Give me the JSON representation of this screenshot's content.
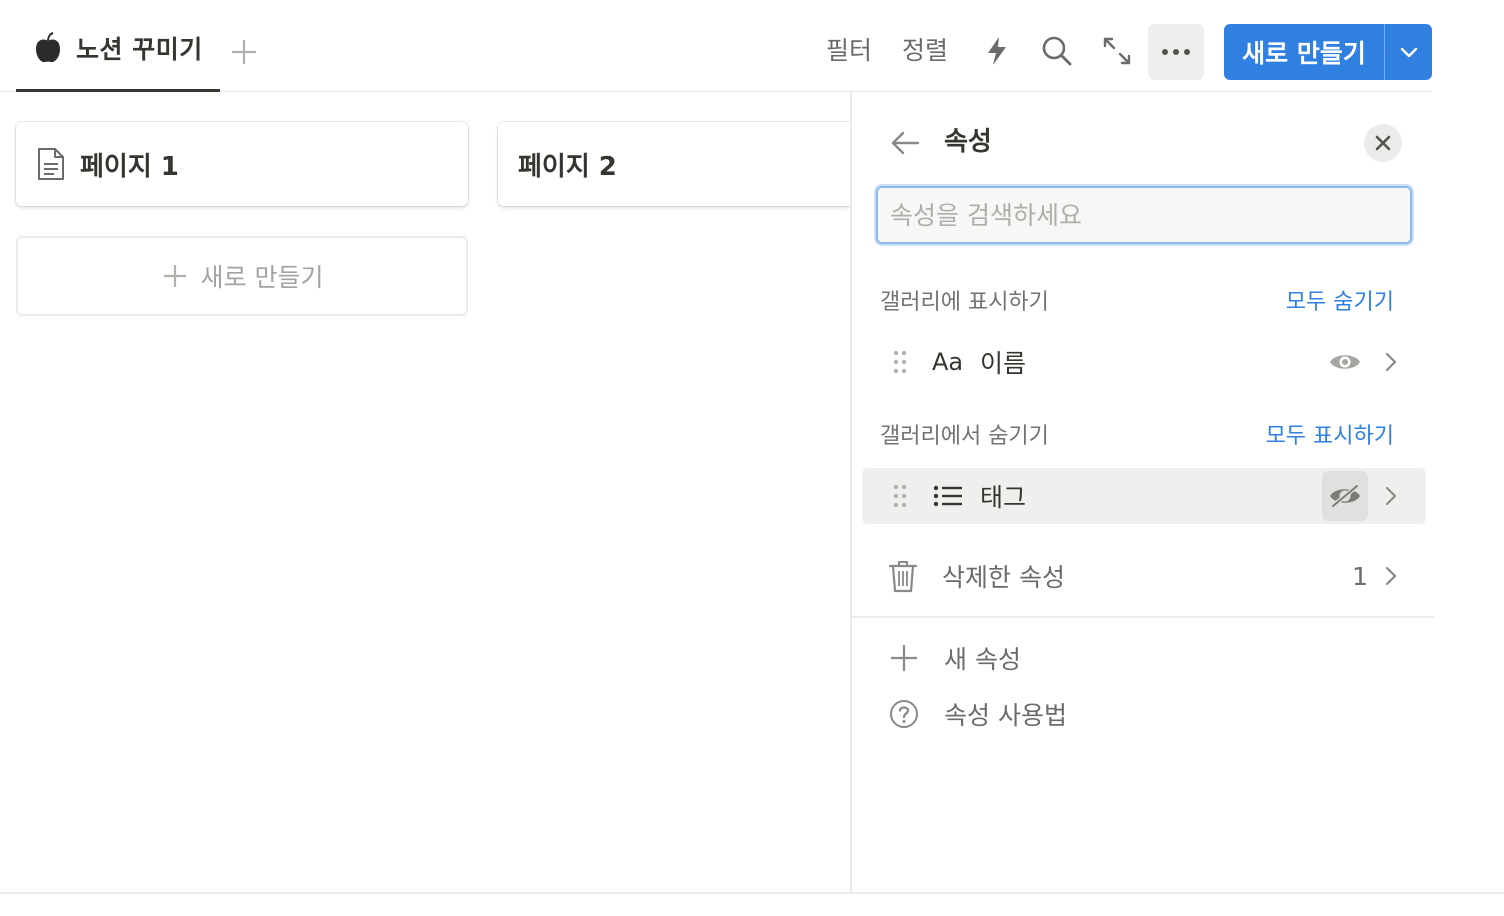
{
  "topbar": {
    "view_tab_label": "노션 꾸미기",
    "filter_label": "필터",
    "sort_label": "정렬",
    "new_button_label": "새로 만들기",
    "icons": [
      "apple-icon",
      "plus-icon",
      "lightning-icon",
      "search-icon",
      "expand-icon",
      "more-icon",
      "chevron-down-icon"
    ]
  },
  "gallery": {
    "cards": [
      {
        "title": "페이지 1",
        "icon": "document-icon"
      },
      {
        "title": "페이지 2"
      }
    ],
    "new_card_label": "새로 만들기"
  },
  "panel": {
    "title": "속성",
    "search_placeholder": "속성을 검색하세요",
    "shown_section": {
      "label": "갤러리에 표시하기",
      "action": "모두 숨기기",
      "items": [
        {
          "type_icon": "Aa",
          "name": "이름",
          "visible": true
        }
      ]
    },
    "hidden_section": {
      "label": "갤러리에서 숨기기",
      "action": "모두 표시하기",
      "items": [
        {
          "type_icon": "list-icon",
          "name": "태그",
          "visible": false
        }
      ]
    },
    "deleted": {
      "label": "삭제한 속성",
      "count": "1"
    },
    "new_property_label": "새 속성",
    "help_label": "속성 사용법"
  },
  "colors": {
    "accent": "#2f80e0",
    "text": "#37352f",
    "muted": "#73726e"
  }
}
